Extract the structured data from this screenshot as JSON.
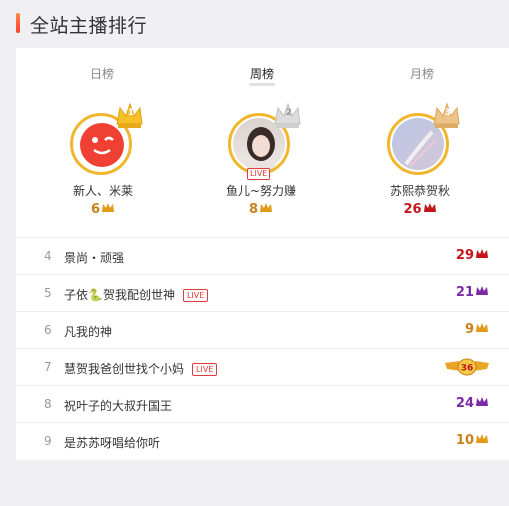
{
  "header": {
    "title": "全站主播排行"
  },
  "tabs": [
    {
      "label": "日榜",
      "active": false
    },
    {
      "label": "周榜",
      "active": true
    },
    {
      "label": "月榜",
      "active": false
    }
  ],
  "podium": [
    {
      "rank": "1",
      "name": "新人、米莱",
      "level": "6",
      "level_color": "#c8821a",
      "live": false
    },
    {
      "rank": "2",
      "name": "鱼儿~努力赚",
      "level": "8",
      "level_color": "#c8821a",
      "live": true,
      "live_label": "LIVE"
    },
    {
      "rank": "3",
      "name": "苏熙恭贺秋",
      "level": "26",
      "level_color": "#c2161b",
      "live": false
    }
  ],
  "list": [
    {
      "rank": "4",
      "name": "景尚・顽强",
      "level": "29",
      "level_color": "#c2161b",
      "live": false
    },
    {
      "rank": "5",
      "name": "子依🐍贺我配创世神",
      "level": "21",
      "level_color": "#7b2aa8",
      "live": true,
      "live_label": "LIVE"
    },
    {
      "rank": "6",
      "name": "凡我的神",
      "level": "9",
      "level_color": "#c8821a",
      "live": false
    },
    {
      "rank": "7",
      "name": "慧贺我爸创世找个小妈",
      "level": "36",
      "level_color": "#c8821a",
      "live": true,
      "live_label": "LIVE",
      "badge": "wing"
    },
    {
      "rank": "8",
      "name": "祝叶子的大叔升国王",
      "level": "24",
      "level_color": "#7b2aa8",
      "live": false
    },
    {
      "rank": "9",
      "name": "是苏苏呀唱给你听",
      "level": "10",
      "level_color": "#c8821a",
      "live": false
    }
  ]
}
